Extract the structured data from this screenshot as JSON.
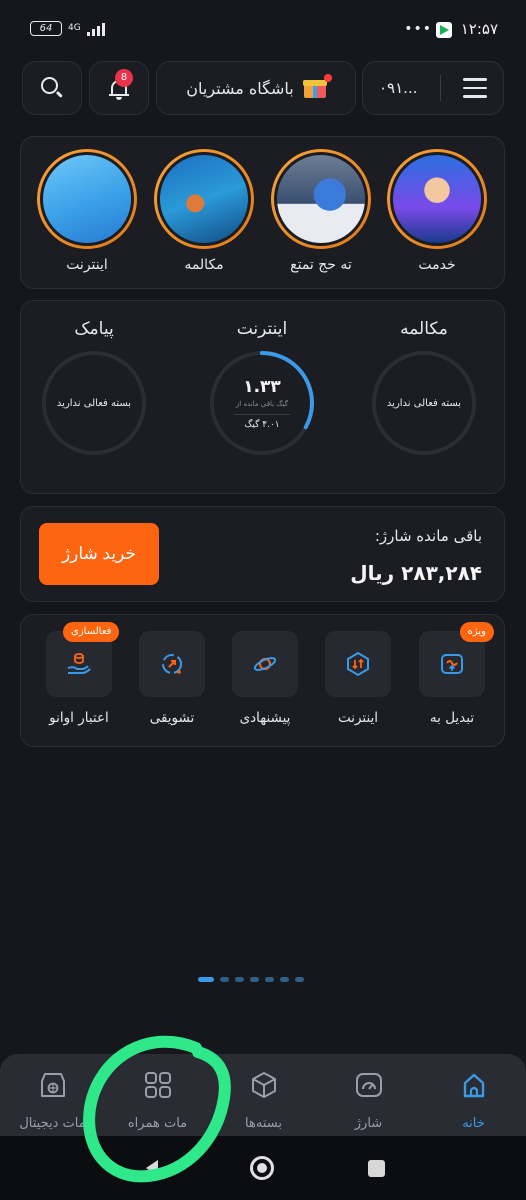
{
  "status": {
    "time": "۱۲:۵۷",
    "battery": "64",
    "network": "4G",
    "dots": "•••"
  },
  "header": {
    "phone": "۰۹۱...",
    "club": "باشگاه مشتریان",
    "notifications": "8",
    "icons": {
      "menu": "hamburger-icon",
      "gift": "gift-icon",
      "bell": "bell-icon",
      "search": "search-icon"
    }
  },
  "stories": [
    {
      "label": "خدمت"
    },
    {
      "label": "ته حج تمتع"
    },
    {
      "label": "مکالمه"
    },
    {
      "label": "اینترنت"
    }
  ],
  "usage": {
    "call": {
      "title": "مکالمه",
      "status": "بسته فعالی ندارید"
    },
    "internet": {
      "title": "اینترنت",
      "remaining": "۱.۳۳",
      "remaining_sub": "گیگ باقی مانده از",
      "total": "۴.۰۱ گیگ",
      "fraction": 0.33
    },
    "sms": {
      "title": "پیامک",
      "status": "بسته فعالی ندارید"
    }
  },
  "charge": {
    "label": "باقی مانده شارژ:",
    "value": "۲۸۳,۲۸۴  ریال",
    "button": "خرید شارژ"
  },
  "services": [
    {
      "name": "تبدیل به",
      "tag": "ویژه",
      "icon": "convert-icon"
    },
    {
      "name": "اینترنت",
      "tag": "",
      "icon": "internet-icon"
    },
    {
      "name": "پیشنهادی",
      "tag": "",
      "icon": "planet-icon"
    },
    {
      "name": "تشویقی",
      "tag": "",
      "icon": "reward-icon"
    },
    {
      "name": "اعتبار اوانو",
      "tag": "فعالسازی",
      "icon": "credit-icon"
    }
  ],
  "pager": {
    "count": 7,
    "active": 0
  },
  "bottom_nav": [
    {
      "label": "خانه",
      "icon": "home-icon",
      "active": true
    },
    {
      "label": "شارژ",
      "icon": "gauge-icon",
      "active": false
    },
    {
      "label": "بسته‌ها",
      "icon": "package-icon",
      "active": false
    },
    {
      "label": "مات همراه",
      "icon": "grid-icon",
      "active": false
    },
    {
      "label": "مات دیجیتال",
      "icon": "store-icon",
      "active": false
    }
  ],
  "colors": {
    "accent": "#fe6510",
    "blue": "#3a9ae8",
    "background": "#15171c",
    "card": "#1b1d23",
    "annotation": "#2ee88a"
  }
}
